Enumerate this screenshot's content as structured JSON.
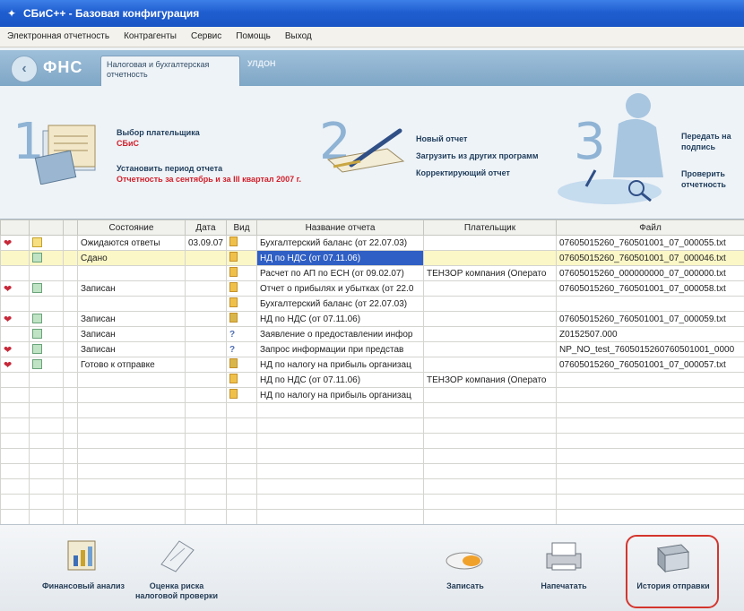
{
  "window": {
    "title": "СБиС++ - Базовая конфигурация"
  },
  "menu": [
    "Электронная отчетность",
    "Контрагенты",
    "Сервис",
    "Помощь",
    "Выход"
  ],
  "nav": {
    "back_glyph": "‹",
    "section": "ФНС",
    "tabs": [
      "Налоговая и бухгалтерская отчетность",
      "УЛДОН"
    ]
  },
  "steps": [
    {
      "number": "1",
      "lines": [
        {
          "text": "Выбор плательщика",
          "red": false
        },
        {
          "text": "СБиС",
          "red": true
        },
        {
          "text": "",
          "red": false
        },
        {
          "text": "Установить период отчета",
          "red": false
        },
        {
          "text": "Отчетность за сентябрь и за III квартал 2007 г.",
          "red": true
        }
      ]
    },
    {
      "number": "2",
      "lines": [
        {
          "text": "Новый отчет",
          "red": false
        },
        {
          "text": "Загрузить из других программ",
          "red": false
        },
        {
          "text": "Корректирующий отчет",
          "red": false
        }
      ]
    },
    {
      "number": "3",
      "lines": [
        {
          "text": "Передать на подпись",
          "red": false
        },
        {
          "text": "",
          "red": false
        },
        {
          "text": "Проверить отчетность",
          "red": false
        }
      ]
    }
  ],
  "grid": {
    "headers": [
      "",
      "",
      "",
      "Состояние",
      "Дата",
      "Вид",
      "Название отчета",
      "Плательщик",
      "Файл"
    ],
    "rows": [
      {
        "heart": true,
        "sticon": "y",
        "state": "Ожидаются ответы",
        "date": "03.09.07",
        "doc": "doc",
        "name": "Бухгалтерский баланс (от 22.07.03)",
        "payer": "",
        "file": "07605015260_760501001_07_000055.txt",
        "sel": false
      },
      {
        "heart": false,
        "sticon": "g",
        "state": "Сдано",
        "date": "",
        "doc": "doc",
        "name": "НД по НДС (от 07.11.06)",
        "payer": "",
        "file": "07605015260_760501001_07_000046.txt",
        "sel": true
      },
      {
        "heart": false,
        "sticon": "",
        "state": "",
        "date": "",
        "doc": "doc",
        "name": "Расчет по АП по ЕСН (от 09.02.07)",
        "payer": "ТЕНЗОР компания (Операто",
        "file": "07605015260_000000000_07_000000.txt",
        "sel": false
      },
      {
        "heart": true,
        "sticon": "g",
        "state": "Записан",
        "date": "",
        "doc": "doc",
        "name": "Отчет о прибылях и убытках (от 22.0",
        "payer": "",
        "file": "07605015260_760501001_07_000058.txt",
        "sel": false
      },
      {
        "heart": false,
        "sticon": "",
        "state": "",
        "date": "",
        "doc": "doc",
        "name": "Бухгалтерский баланс (от 22.07.03)",
        "payer": "",
        "file": "",
        "sel": false
      },
      {
        "heart": true,
        "sticon": "g",
        "state": "Записан",
        "date": "",
        "doc": "warn",
        "name": "НД по НДС (от 07.11.06)",
        "payer": "",
        "file": "07605015260_760501001_07_000059.txt",
        "sel": false
      },
      {
        "heart": false,
        "sticon": "g",
        "state": "Записан",
        "date": "",
        "doc": "q",
        "name": "Заявление о предоставлении инфор",
        "payer": "",
        "file": "Z0152507.000",
        "sel": false
      },
      {
        "heart": true,
        "sticon": "g",
        "state": "Записан",
        "date": "",
        "doc": "q",
        "name": "Запрос информации при представ",
        "payer": "",
        "file": "NP_NO_test_7605015260760501001_0000",
        "sel": false
      },
      {
        "heart": true,
        "sticon": "g",
        "state": "Готово к отправке",
        "date": "",
        "doc": "warn",
        "name": "НД по налогу на прибыль организац",
        "payer": "",
        "file": "07605015260_760501001_07_000057.txt",
        "sel": false
      },
      {
        "heart": false,
        "sticon": "",
        "state": "",
        "date": "",
        "doc": "doc",
        "name": "НД по НДС (от 07.11.06)",
        "payer": "ТЕНЗОР компания (Операто",
        "file": "",
        "sel": false
      },
      {
        "heart": false,
        "sticon": "",
        "state": "",
        "date": "",
        "doc": "doc",
        "name": "НД по налогу на прибыль организац",
        "payer": "",
        "file": "",
        "sel": false
      }
    ],
    "empty_rows": 9
  },
  "bottom_tools": [
    {
      "id": "financial-analysis",
      "label": "Финансовый анализ"
    },
    {
      "id": "risk-assessment",
      "label": "Оценка риска налоговой проверки"
    },
    {
      "id": "record",
      "label": "Записать"
    },
    {
      "id": "print",
      "label": "Напечатать"
    },
    {
      "id": "send-history",
      "label": "История отправки"
    }
  ]
}
